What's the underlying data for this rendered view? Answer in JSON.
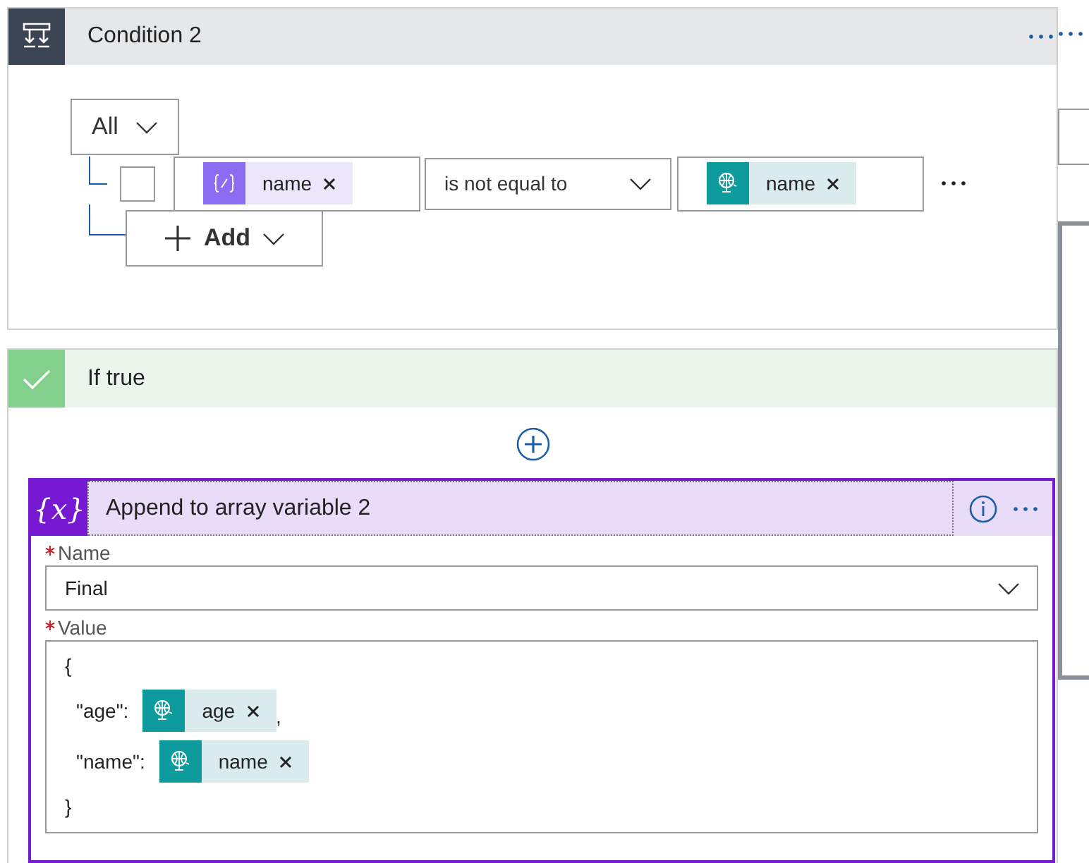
{
  "condition": {
    "title": "Condition 2",
    "group_operator": "All",
    "rows": [
      {
        "checked": false,
        "left": {
          "kind": "variable",
          "label": "name"
        },
        "operator": "is not equal to",
        "right": {
          "kind": "http",
          "label": "name"
        }
      }
    ],
    "add_button": "Add"
  },
  "if_true": {
    "title": "If true"
  },
  "action": {
    "icon_label": "{x}",
    "title": "Append to array variable 2",
    "fields": [
      {
        "kind": "dropdown",
        "label": "Name",
        "required": true,
        "value": "Final"
      },
      {
        "kind": "editor",
        "label": "Value",
        "required": true,
        "lines": [
          {
            "text": "{"
          },
          {
            "key": "\"age\":",
            "token": {
              "kind": "http",
              "label": "age"
            },
            "suffix": ","
          },
          {
            "key": "\"name\":",
            "token": {
              "kind": "http",
              "label": "name"
            }
          },
          {
            "text": "}"
          }
        ]
      }
    ]
  }
}
